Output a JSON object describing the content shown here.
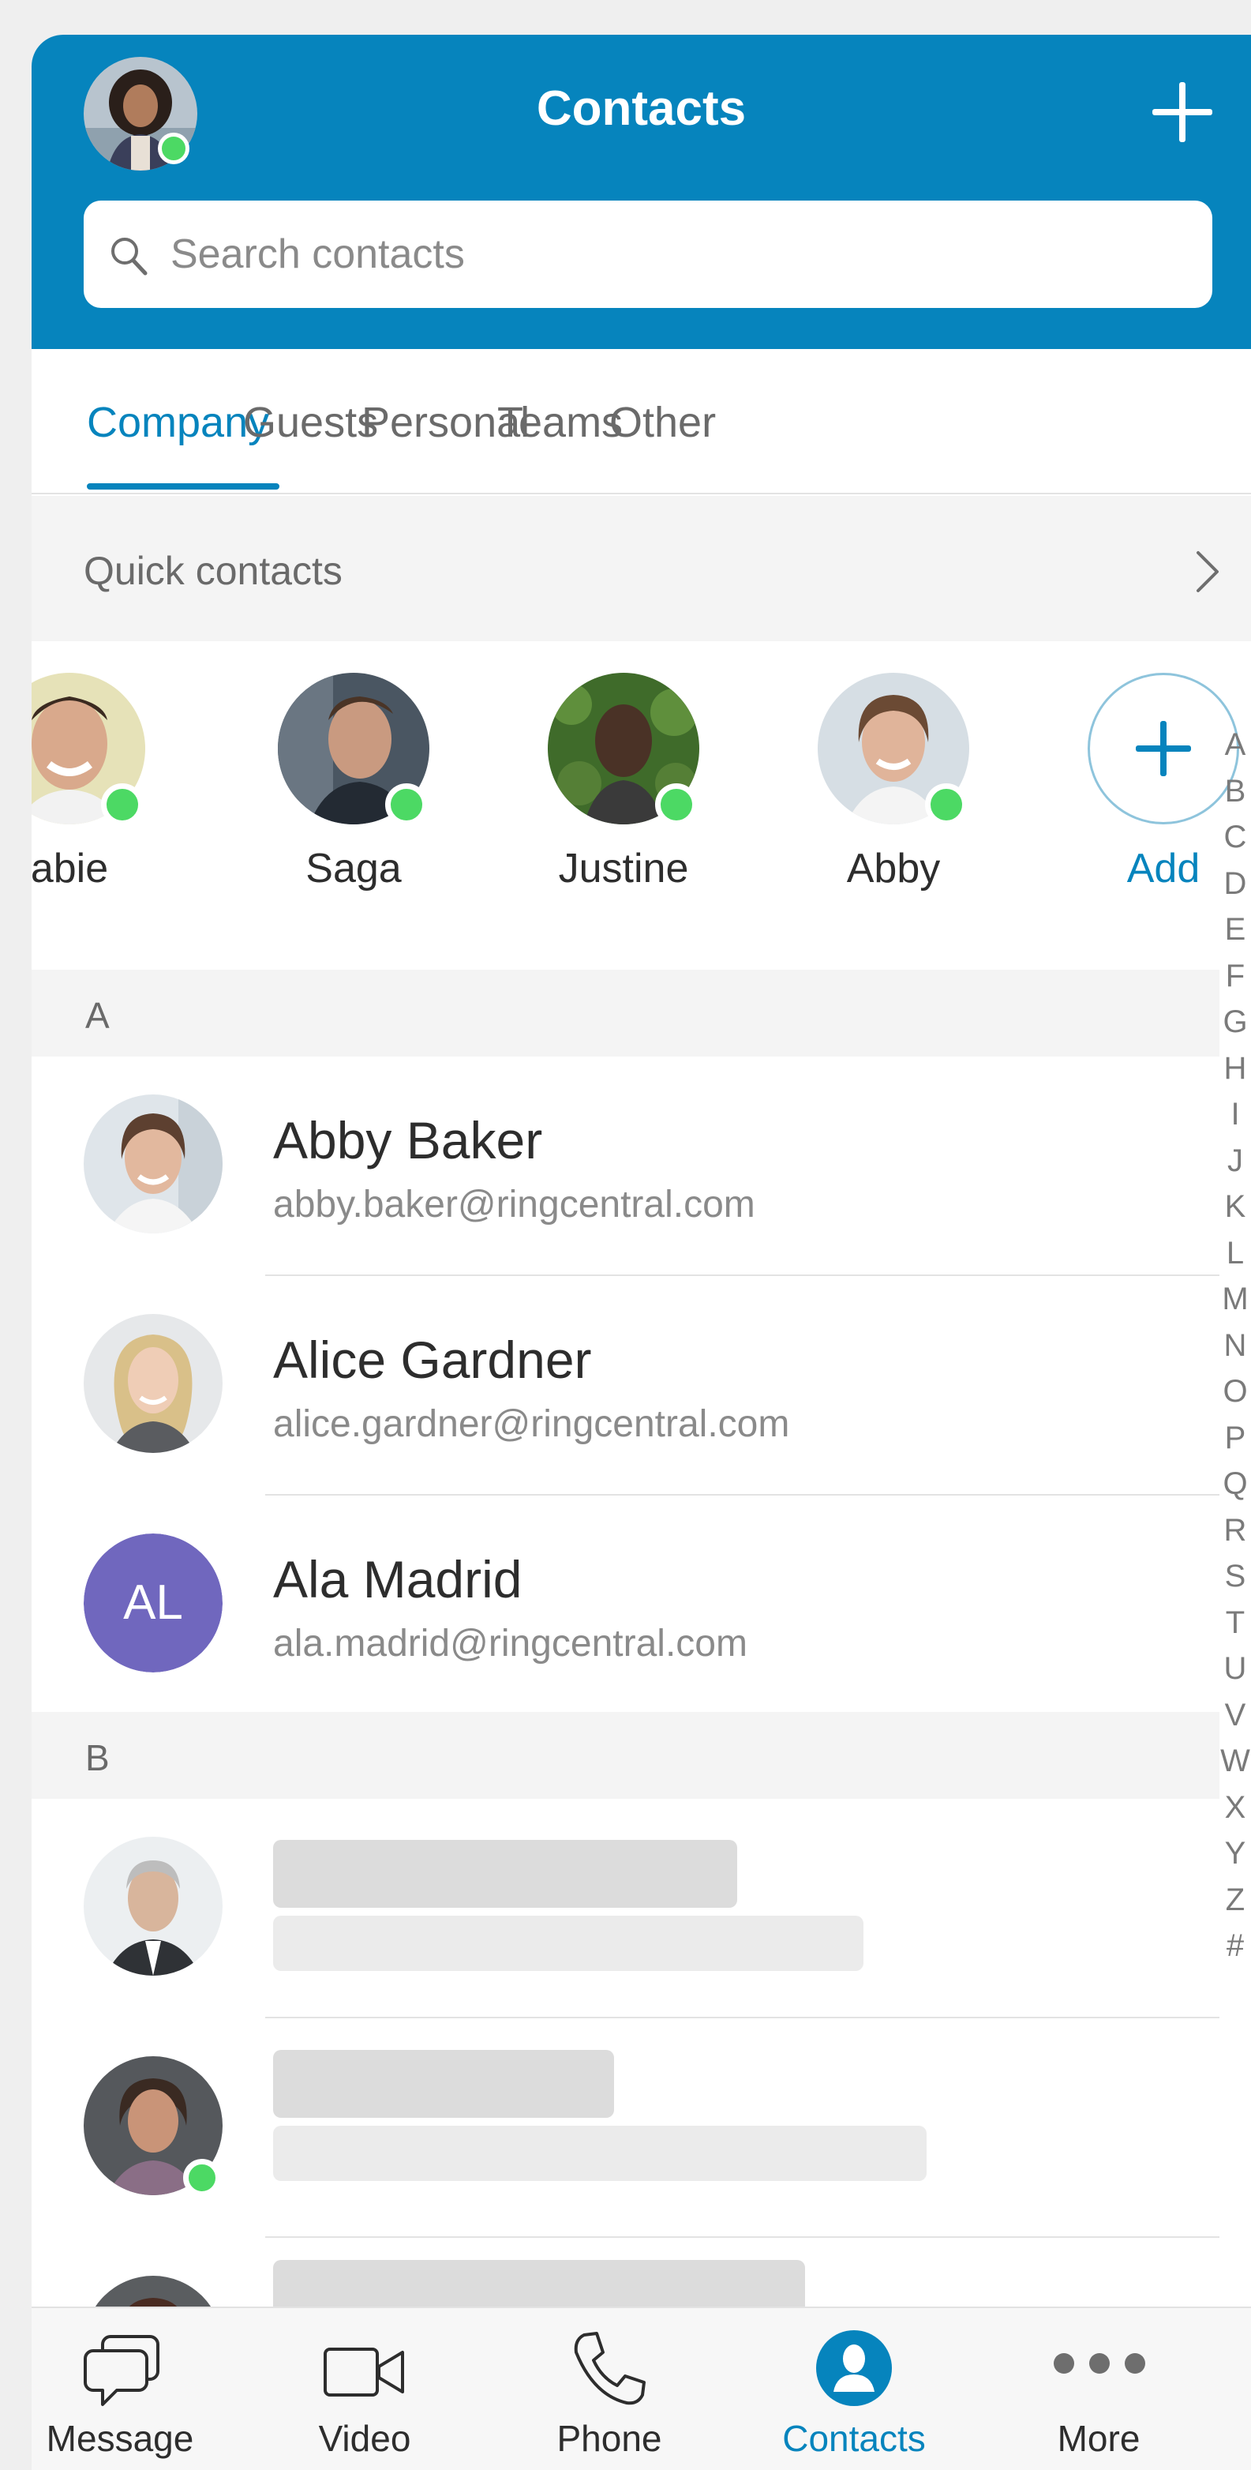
{
  "header": {
    "title": "Contacts",
    "add_icon": "plus-icon",
    "search_placeholder": "Search contacts",
    "accent_color": "#0684bd"
  },
  "tabs": [
    {
      "label": "Company",
      "active": true
    },
    {
      "label": "Guests",
      "active": false
    },
    {
      "label": "Personal",
      "active": false
    },
    {
      "label": "Teams",
      "active": false
    },
    {
      "label": "Other",
      "active": false
    }
  ],
  "quick_contacts": {
    "title": "Quick contacts",
    "items": [
      {
        "name": "abie",
        "online": true
      },
      {
        "name": "Saga",
        "online": true
      },
      {
        "name": "Justine",
        "online": true
      },
      {
        "name": "Abby",
        "online": true
      }
    ],
    "add_label": "Add"
  },
  "alpha_index": [
    "A",
    "B",
    "C",
    "D",
    "E",
    "F",
    "G",
    "H",
    "I",
    "J",
    "K",
    "L",
    "M",
    "N",
    "O",
    "P",
    "Q",
    "R",
    "S",
    "T",
    "U",
    "V",
    "W",
    "X",
    "Y",
    "Z",
    "#"
  ],
  "sections": [
    {
      "letter": "A",
      "contacts": [
        {
          "name": "Abby Baker",
          "email": "abby.baker@ringcentral.com"
        },
        {
          "name": "Alice Gardner",
          "email": "alice.gardner@ringcentral.com"
        },
        {
          "name": "Ala Madrid",
          "email": "ala.madrid@ringcentral.com",
          "initials": "AL",
          "avatar_color": "#7067be"
        }
      ]
    },
    {
      "letter": "B",
      "contacts": [
        {
          "loading": true
        },
        {
          "loading": true,
          "online": true
        },
        {
          "loading": true
        }
      ]
    }
  ],
  "bottom_nav": [
    {
      "label": "Message",
      "icon": "message-icon",
      "active": false
    },
    {
      "label": "Video",
      "icon": "video-icon",
      "active": false
    },
    {
      "label": "Phone",
      "icon": "phone-icon",
      "active": false
    },
    {
      "label": "Contacts",
      "icon": "contacts-icon",
      "active": true
    },
    {
      "label": "More",
      "icon": "more-icon",
      "active": false
    }
  ]
}
